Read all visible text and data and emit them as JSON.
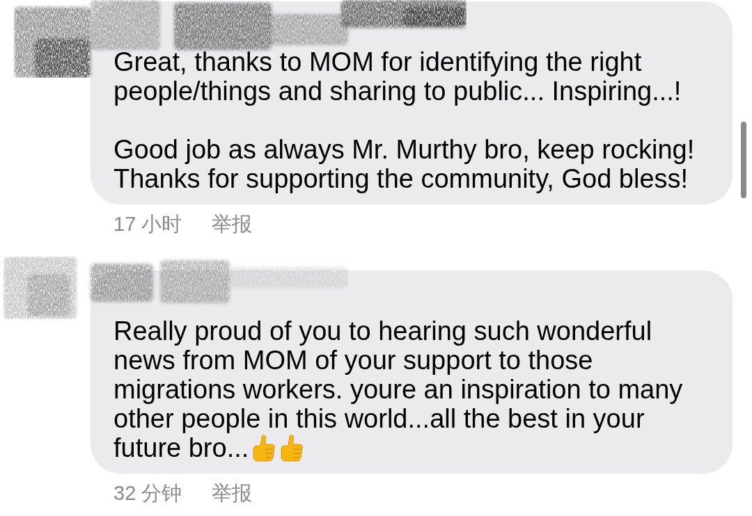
{
  "comments": [
    {
      "name_redacted": true,
      "paragraphs": [
        {
          "text": "Great, thanks to MOM for identifying the right people/things and sharing to public... Inspiring...!"
        },
        {
          "text": "Good job as always Mr. Murthy bro, keep rocking! Thanks for supporting the community, God bless!"
        }
      ],
      "time": "17 小时",
      "report_link": "举报"
    },
    {
      "name_redacted": true,
      "paragraphs": [
        {
          "text": "Really proud of you to hearing such wonderful news from MOM of your support to those migrations workers. youre an inspiration to many other people in this world...all the best in your future bro...",
          "emojis": [
            {
              "kind": "thumbs_up"
            },
            {
              "kind": "thumbs_up"
            }
          ]
        }
      ],
      "time": "32 分钟",
      "report_link": "举报"
    }
  ]
}
